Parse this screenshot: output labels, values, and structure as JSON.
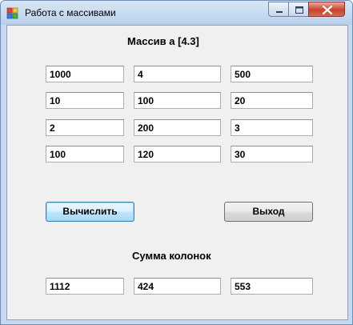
{
  "window": {
    "title": "Работа с массивами"
  },
  "form": {
    "array_heading": "Массив а [4.3]",
    "matrix": [
      [
        "1000",
        "4",
        "500"
      ],
      [
        "10",
        "100",
        "20"
      ],
      [
        "2",
        "200",
        "3"
      ],
      [
        "100",
        "120",
        "30"
      ]
    ],
    "compute_label": "Вычислить",
    "exit_label": "Выход",
    "sum_heading": "Сумма колонок",
    "sums": [
      "1112",
      "424",
      "553"
    ]
  },
  "icons": {
    "app": "app-icon",
    "minimize": "minimize-icon",
    "maximize": "maximize-icon",
    "close": "close-icon"
  },
  "colors": {
    "close_button": "#c7432d",
    "focus_border": "#3c7fb1"
  }
}
